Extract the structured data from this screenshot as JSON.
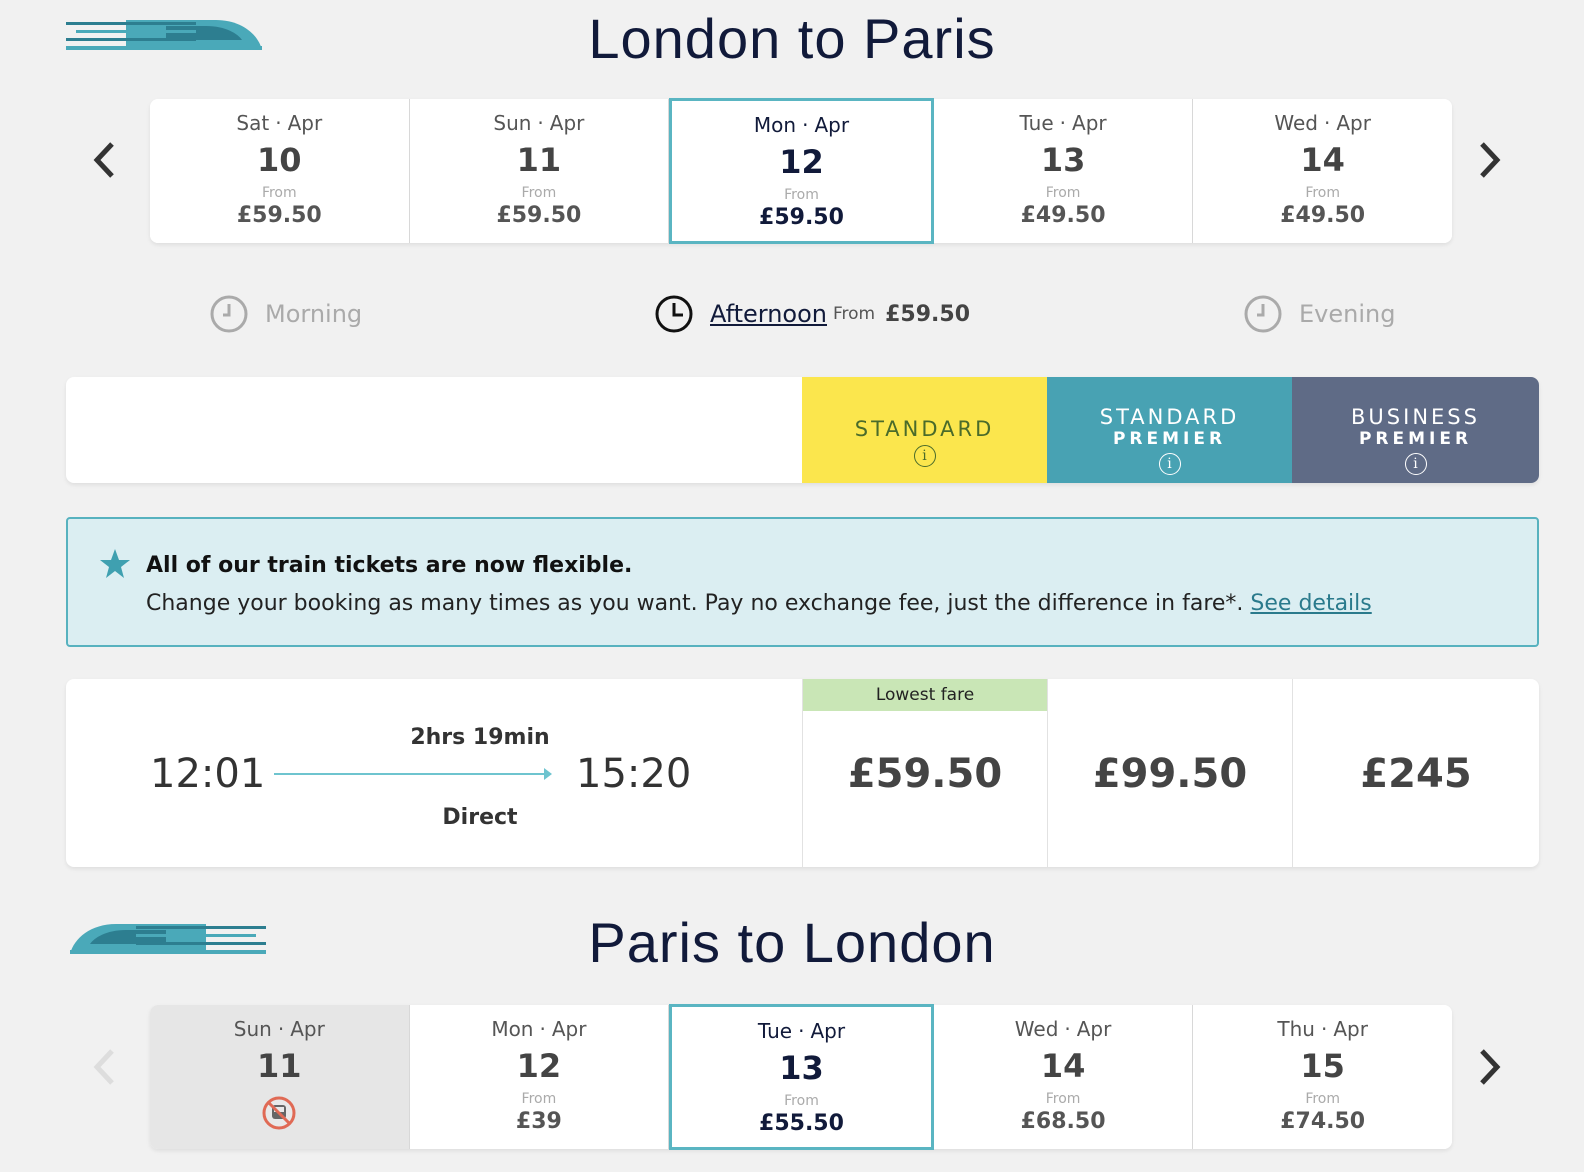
{
  "outbound": {
    "title": "London to Paris",
    "dates": [
      {
        "day": "Sat",
        "month": "Apr",
        "num": "10",
        "from": "From",
        "price": "£59.50"
      },
      {
        "day": "Sun",
        "month": "Apr",
        "num": "11",
        "from": "From",
        "price": "£59.50"
      },
      {
        "day": "Mon",
        "month": "Apr",
        "num": "12",
        "from": "From",
        "price": "£59.50"
      },
      {
        "day": "Tue",
        "month": "Apr",
        "num": "13",
        "from": "From",
        "price": "£49.50"
      },
      {
        "day": "Wed",
        "month": "Apr",
        "num": "14",
        "from": "From",
        "price": "£49.50"
      }
    ],
    "time_of_day": {
      "morning": "Morning",
      "afternoon": "Afternoon",
      "afternoon_from": "From",
      "afternoon_price": "£59.50",
      "evening": "Evening"
    },
    "classes": {
      "standard": "STANDARD",
      "standard_premier_1": "STANDARD",
      "standard_premier_2": "PREMIER",
      "business_premier_1": "BUSINESS",
      "business_premier_2": "PREMIER",
      "colors": {
        "standard": "#fbe64d",
        "standard_premier": "#48a2b3",
        "business_premier": "#5f6b86"
      }
    },
    "notice": {
      "title": "All of our train tickets are now flexible.",
      "body": "Change your booking as many times as you want. Pay no exchange fee, just the difference in fare*.",
      "link": "See details"
    },
    "journey": {
      "depart": "12:01",
      "arrive": "15:20",
      "duration": "2hrs 19min",
      "type": "Direct",
      "badge": "Lowest fare",
      "fares": [
        "£59.50",
        "£99.50",
        "£245"
      ]
    }
  },
  "inbound": {
    "title": "Paris to London",
    "dates": [
      {
        "day": "Sun",
        "month": "Apr",
        "num": "11",
        "from": "",
        "price": ""
      },
      {
        "day": "Mon",
        "month": "Apr",
        "num": "12",
        "from": "From",
        "price": "£39"
      },
      {
        "day": "Tue",
        "month": "Apr",
        "num": "13",
        "from": "From",
        "price": "£55.50"
      },
      {
        "day": "Wed",
        "month": "Apr",
        "num": "14",
        "from": "From",
        "price": "£68.50"
      },
      {
        "day": "Thu",
        "month": "Apr",
        "num": "15",
        "from": "From",
        "price": "£74.50"
      }
    ]
  },
  "icons": {
    "prev": "chevron-left-icon",
    "next": "chevron-right-icon",
    "clock": "clock-icon",
    "star": "star-icon",
    "info": "info-icon",
    "no_train": "no-train-icon",
    "train_logo": "train-logo"
  }
}
